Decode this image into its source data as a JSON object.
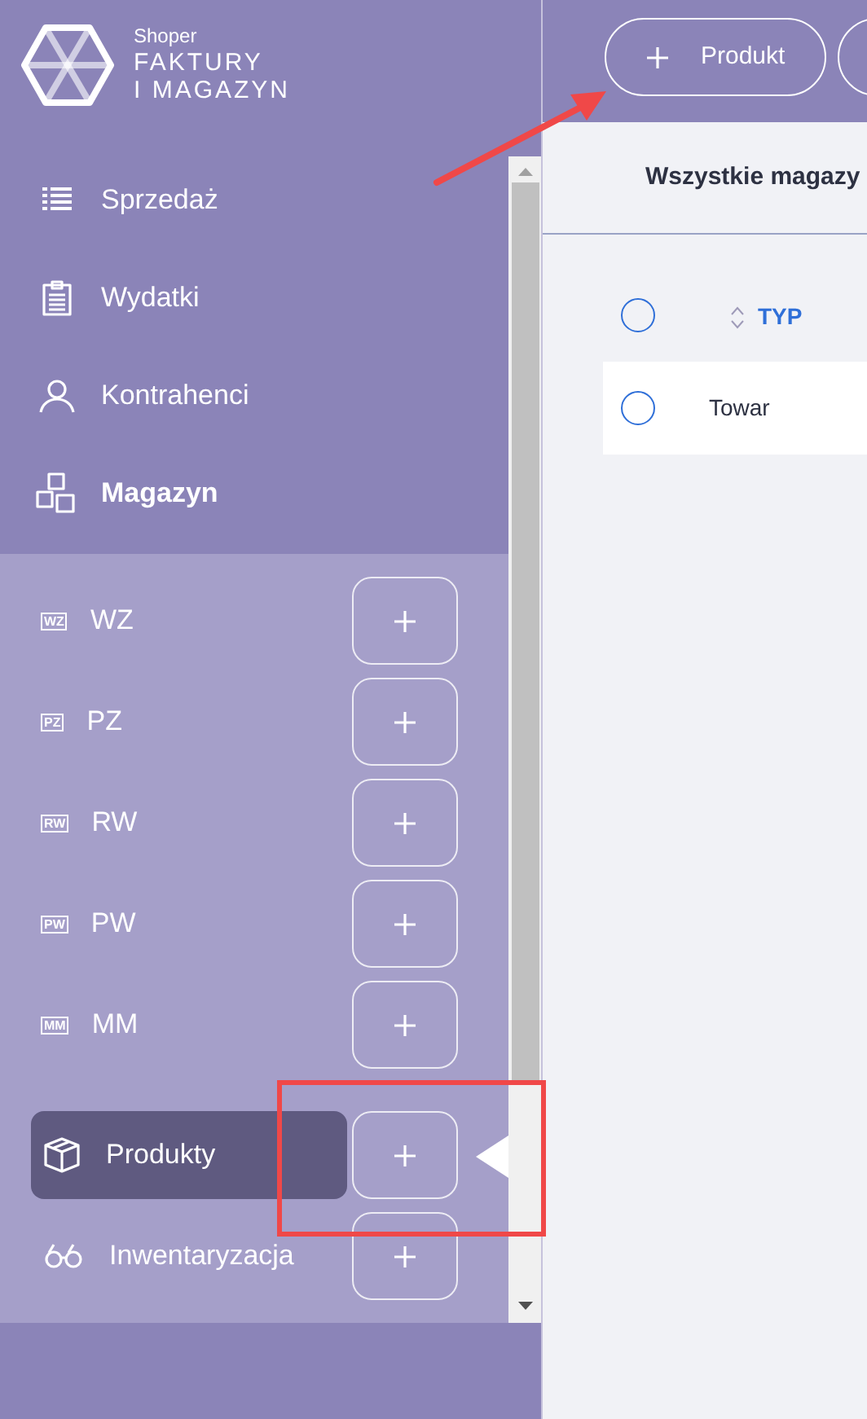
{
  "logo": {
    "brand": "Shoper",
    "line1": "FAKTURY",
    "line2": "I MAGAZYN"
  },
  "header_button": {
    "label": "Produkt"
  },
  "nav": [
    {
      "label": "Sprzedaż",
      "kind": "list",
      "active": false
    },
    {
      "label": "Wydatki",
      "kind": "clipboard",
      "active": false
    },
    {
      "label": "Kontrahenci",
      "kind": "person",
      "active": false
    },
    {
      "label": "Magazyn",
      "kind": "boxes",
      "active": true
    }
  ],
  "sub_items": [
    {
      "label": "WZ",
      "kind": "code",
      "code": "WZ",
      "selected": false
    },
    {
      "label": "PZ",
      "kind": "code",
      "code": "PZ",
      "selected": false
    },
    {
      "label": "RW",
      "kind": "code",
      "code": "RW",
      "selected": false
    },
    {
      "label": "PW",
      "kind": "code",
      "code": "PW",
      "selected": false
    },
    {
      "label": "MM",
      "kind": "code",
      "code": "MM",
      "selected": false
    },
    {
      "label": "Produkty",
      "kind": "box",
      "selected": true
    },
    {
      "label": "Inwentaryzacja",
      "kind": "glasses",
      "selected": false
    }
  ],
  "main": {
    "tab": "Wszystkie magazy",
    "table": {
      "columns": [
        {
          "label": "TYP"
        }
      ],
      "header_checked": false,
      "rows": [
        {
          "cells": [
            "Towar"
          ],
          "checked": false
        }
      ]
    }
  }
}
